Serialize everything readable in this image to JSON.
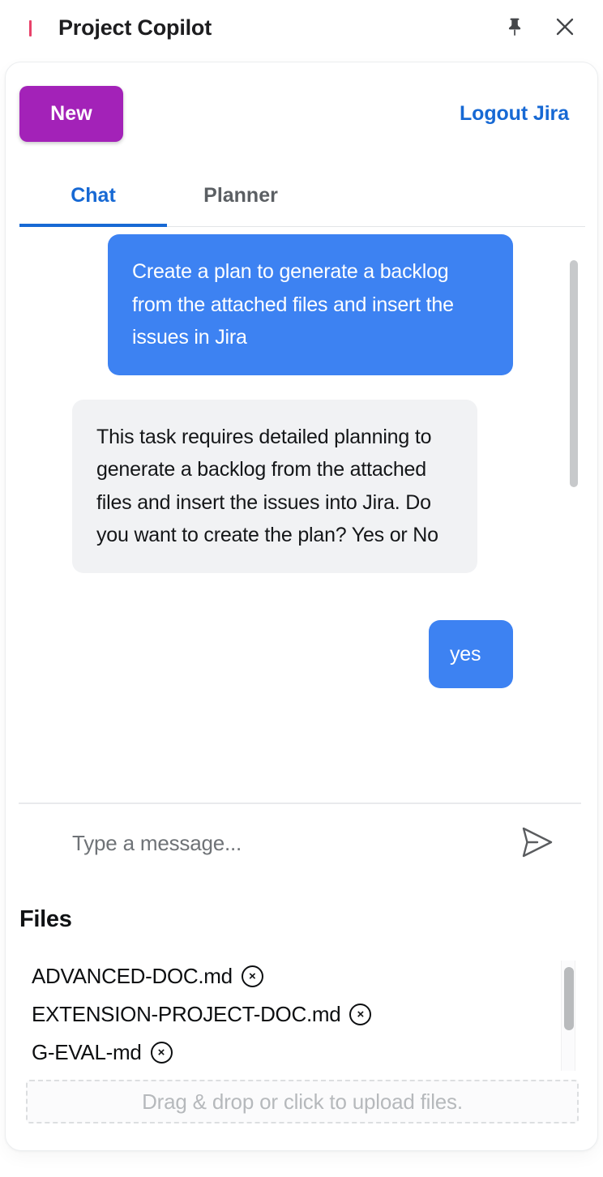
{
  "titlebar": {
    "title": "Project Copilot",
    "pin_icon": "pin-icon",
    "close_icon": "close-icon"
  },
  "toolbar": {
    "new_label": "New",
    "logout_label": "Logout Jira"
  },
  "tabs": [
    {
      "label": "Chat",
      "active": true
    },
    {
      "label": "Planner",
      "active": false
    }
  ],
  "chat": {
    "messages": [
      {
        "role": "user",
        "text": "Create a plan to generate a backlog from the attached files and insert the issues in Jira"
      },
      {
        "role": "assistant",
        "text": "This task requires detailed planning to generate a backlog from the attached files and insert the issues into Jira. Do you want to create the plan? Yes or No"
      },
      {
        "role": "user",
        "text": "yes"
      }
    ]
  },
  "composer": {
    "placeholder": "Type a message...",
    "value": "",
    "send_icon": "send-icon"
  },
  "files": {
    "heading": "Files",
    "items": [
      {
        "name": "ADVANCED-DOC.md",
        "remove_label": "×"
      },
      {
        "name": "EXTENSION-PROJECT-DOC.md",
        "remove_label": "×"
      },
      {
        "name": "G-EVAL-md",
        "remove_label": "×"
      }
    ]
  },
  "dropzone": {
    "text": "Drag & drop or click to upload files."
  },
  "colors": {
    "accent_blue": "#3d82f2",
    "link_blue": "#1769d4",
    "new_purple": "#a322b8",
    "bot_bubble": "#f1f2f4",
    "brand_pink": "#e8426a"
  }
}
